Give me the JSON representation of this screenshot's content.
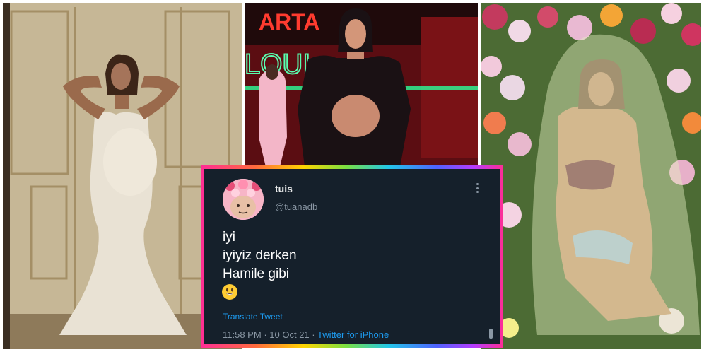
{
  "panels": {
    "center_sign_top": "ARTA",
    "center_sign_neon": "LOUI"
  },
  "tweet": {
    "display_name": "tuis",
    "handle": "@tuanadb",
    "lines": [
      "iyi",
      "iyiyiz derken",
      "Hamile gibi"
    ],
    "emoji": "grinning-face-emoji",
    "translate_label": "Translate Tweet",
    "time": "11:58 PM",
    "separator": "·",
    "date": "10 Oct 21",
    "source": "Twitter for iPhone"
  },
  "colors": {
    "tweet_background": "#15202b",
    "link_blue": "#1d9bf0",
    "muted_text": "#8b98a5",
    "frame_gradient": [
      "#ff2d95",
      "#ff6a3d",
      "#ffd400",
      "#7be041",
      "#22c7e8",
      "#4f63ff",
      "#b43cff"
    ]
  }
}
